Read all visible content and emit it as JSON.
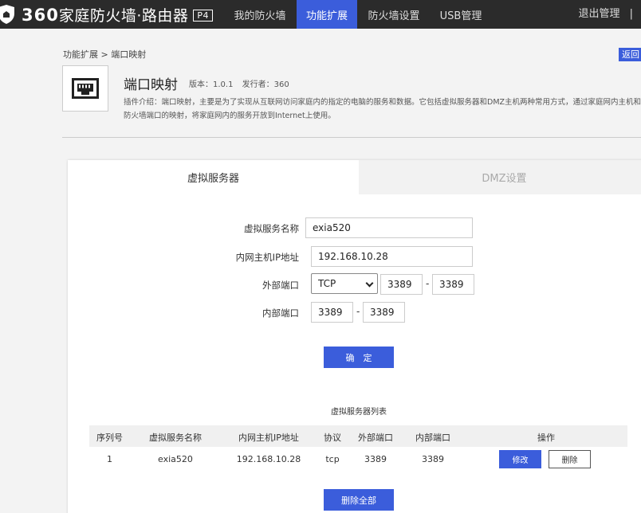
{
  "header": {
    "brand_number": "360",
    "brand_text": "家庭防火墙·路由器",
    "model_badge": "P4",
    "nav": [
      "我的防火墙",
      "功能扩展",
      "防火墙设置",
      "USB管理"
    ],
    "active_nav": 1,
    "logout": "退出管理",
    "logout_sep": "|"
  },
  "breadcrumb": "功能扩展 > 端口映射",
  "back_label": "返回",
  "plugin": {
    "icon": "ethernet-port-icon",
    "title": "端口映射",
    "version": "版本：1.0.1",
    "publisher": "发行者：360",
    "description": "插件介绍：端口映射，主要是为了实现从互联网访问家庭内的指定的电脑的服务和数据。它包括虚拟服务器和DMZ主机两种常用方式，通过家庭网内主机和防火墙端口的映射，将家庭网内的服务开放到Internet上使用。"
  },
  "tabs": [
    "虚拟服务器",
    "DMZ设置"
  ],
  "form": {
    "name_label": "虚拟服务名称",
    "name_value": "exia520",
    "ip_label": "内网主机IP地址",
    "ip_value": "192.168.10.28",
    "ext_label": "外部端口",
    "protocol": "TCP",
    "ext_start": "3389",
    "ext_end": "3389",
    "int_label": "内部端口",
    "int_start": "3389",
    "int_end": "3389",
    "dash": "-",
    "confirm": "确　定"
  },
  "list": {
    "title": "虚拟服务器列表",
    "headers": [
      "序列号",
      "虚拟服务名称",
      "内网主机IP地址",
      "协议",
      "外部端口",
      "内部端口",
      "操作"
    ],
    "rows": [
      {
        "index": "1",
        "name": "exia520",
        "ip": "192.168.10.28",
        "protocol": "tcp",
        "ext": "3389",
        "int": "3389"
      }
    ],
    "edit": "修改",
    "delete": "删除",
    "delete_all": "删除全部"
  },
  "colors": {
    "topbar": "#2b2b2b",
    "accent": "#3b5ddb"
  }
}
